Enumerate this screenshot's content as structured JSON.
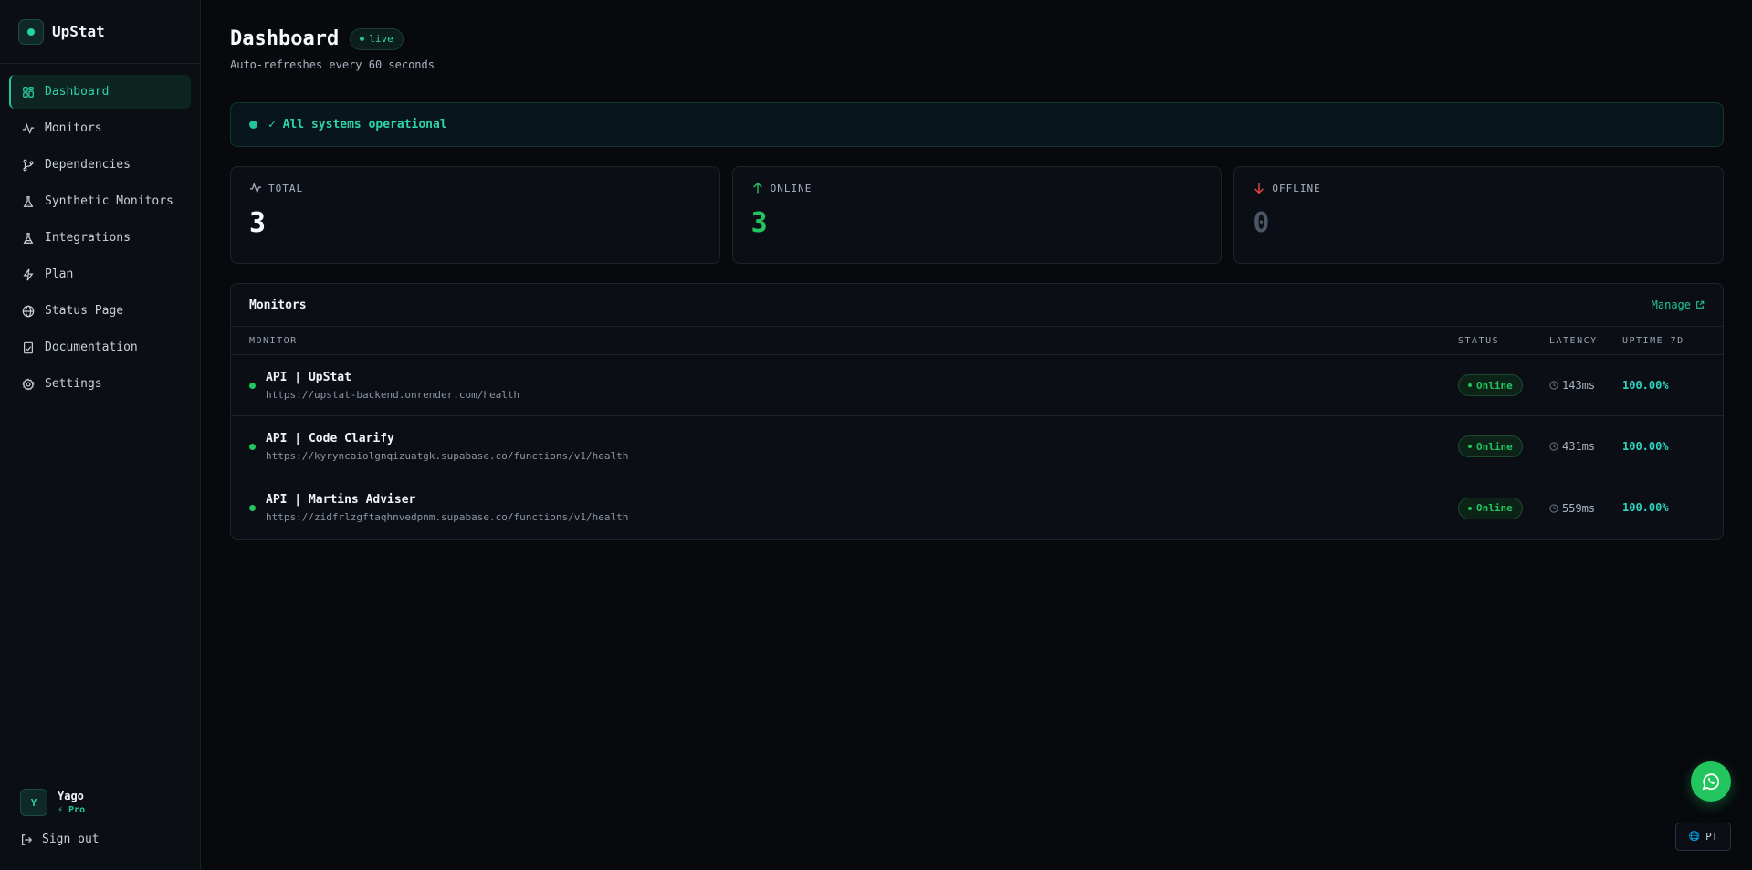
{
  "brand": {
    "name": "UpStat"
  },
  "sidebar": {
    "items": [
      {
        "label": "Dashboard",
        "icon": "grid-icon",
        "active": true
      },
      {
        "label": "Monitors",
        "icon": "activity-icon"
      },
      {
        "label": "Dependencies",
        "icon": "git-branch-icon"
      },
      {
        "label": "Synthetic Monitors",
        "icon": "flask-icon"
      },
      {
        "label": "Integrations",
        "icon": "flask-icon"
      },
      {
        "label": "Plan",
        "icon": "zap-icon"
      },
      {
        "label": "Status Page",
        "icon": "globe-icon"
      },
      {
        "label": "Documentation",
        "icon": "book-icon"
      },
      {
        "label": "Settings",
        "icon": "gear-icon"
      }
    ],
    "user": {
      "initial": "Y",
      "name": "Yago",
      "plan": "⚡ Pro"
    },
    "sign_out": "Sign out"
  },
  "header": {
    "title": "Dashboard",
    "live_badge": "live",
    "subtitle": "Auto-refreshes every 60 seconds"
  },
  "banner": {
    "text": "✓ All systems operational"
  },
  "stats": [
    {
      "label": "TOTAL",
      "value": "3"
    },
    {
      "label": "ONLINE",
      "value": "3"
    },
    {
      "label": "OFFLINE",
      "value": "0"
    }
  ],
  "monitors": {
    "title": "Monitors",
    "manage": "Manage",
    "columns": {
      "monitor": "MONITOR",
      "status": "STATUS",
      "latency": "LATENCY",
      "uptime": "UPTIME 7D"
    },
    "rows": [
      {
        "name": "API | UpStat",
        "url": "https://upstat-backend.onrender.com/health",
        "status": "Online",
        "latency": "143ms",
        "uptime": "100.00%"
      },
      {
        "name": "API | Code Clarify",
        "url": "https://kyryncaiolgnqizuatgk.supabase.co/functions/v1/health",
        "status": "Online",
        "latency": "431ms",
        "uptime": "100.00%"
      },
      {
        "name": "API | Martins Adviser",
        "url": "https://zidfrlzgftaqhnvedpnm.supabase.co/functions/v1/health",
        "status": "Online",
        "latency": "559ms",
        "uptime": "100.00%"
      }
    ]
  },
  "language": {
    "label": "PT"
  },
  "colors": {
    "accent": "#22c59b",
    "online": "#22c55e",
    "offline_arrow": "#ef4444",
    "background": "#07090d"
  }
}
